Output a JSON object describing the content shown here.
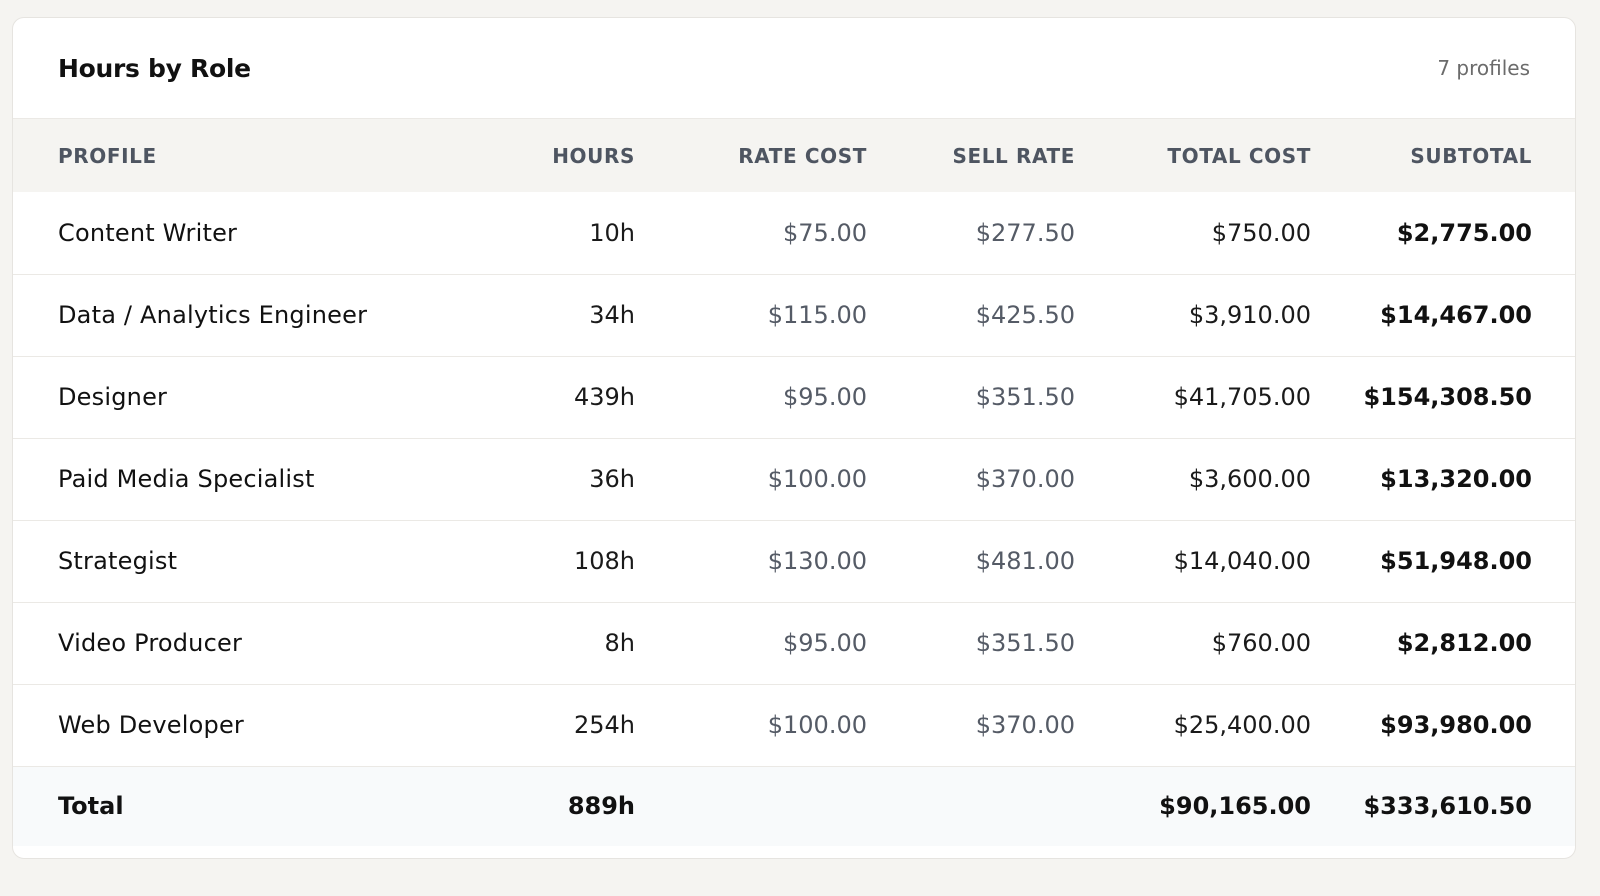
{
  "card": {
    "title": "Hours by Role",
    "count": "7 profiles"
  },
  "table": {
    "columns": [
      "PROFILE",
      "HOURS",
      "RATE COST",
      "SELL RATE",
      "TOTAL COST",
      "SUBTOTAL"
    ],
    "rows": [
      {
        "profile": "Content Writer",
        "hours": "10h",
        "rate_cost": "$75.00",
        "sell_rate": "$277.50",
        "total_cost": "$750.00",
        "subtotal": "$2,775.00"
      },
      {
        "profile": "Data / Analytics Engineer",
        "hours": "34h",
        "rate_cost": "$115.00",
        "sell_rate": "$425.50",
        "total_cost": "$3,910.00",
        "subtotal": "$14,467.00"
      },
      {
        "profile": "Designer",
        "hours": "439h",
        "rate_cost": "$95.00",
        "sell_rate": "$351.50",
        "total_cost": "$41,705.00",
        "subtotal": "$154,308.50"
      },
      {
        "profile": "Paid Media Specialist",
        "hours": "36h",
        "rate_cost": "$100.00",
        "sell_rate": "$370.00",
        "total_cost": "$3,600.00",
        "subtotal": "$13,320.00"
      },
      {
        "profile": "Strategist",
        "hours": "108h",
        "rate_cost": "$130.00",
        "sell_rate": "$481.00",
        "total_cost": "$14,040.00",
        "subtotal": "$51,948.00"
      },
      {
        "profile": "Video Producer",
        "hours": "8h",
        "rate_cost": "$95.00",
        "sell_rate": "$351.50",
        "total_cost": "$760.00",
        "subtotal": "$2,812.00"
      },
      {
        "profile": "Web Developer",
        "hours": "254h",
        "rate_cost": "$100.00",
        "sell_rate": "$370.00",
        "total_cost": "$25,400.00",
        "subtotal": "$93,980.00"
      }
    ],
    "total": {
      "label": "Total",
      "hours": "889h",
      "total_cost": "$90,165.00",
      "subtotal": "$333,610.50"
    }
  },
  "colors": {
    "page_bg": "#f5f4f1",
    "card_bg": "#ffffff",
    "header_row_bg": "#f5f4f1",
    "total_row_bg": "#f8fafb",
    "muted_text": "#555b66"
  }
}
